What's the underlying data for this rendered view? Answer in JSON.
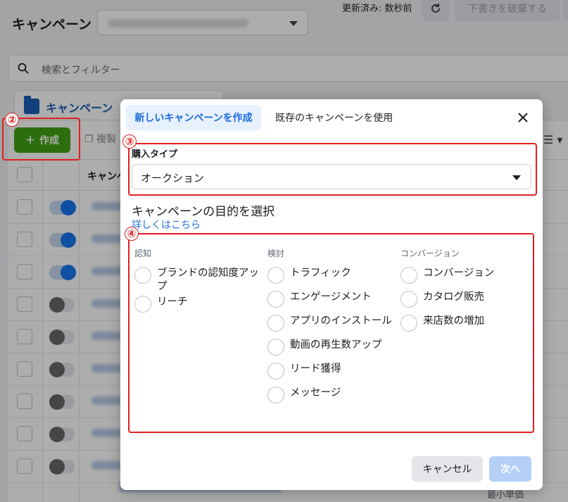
{
  "header": {
    "title": "キャンペーン",
    "updated_text": "更新済み: 数秒前",
    "discard_label": "下書きを破棄する"
  },
  "search": {
    "placeholder": "検索とフィルター"
  },
  "tabs": {
    "campaign_label": "キャンペーン"
  },
  "toolbar": {
    "create_label": "作成",
    "duplicate_label": "複製"
  },
  "table": {
    "header_name": "キャンペ",
    "rows": [
      {
        "toggle": "on"
      },
      {
        "toggle": "on"
      },
      {
        "toggle": "on"
      },
      {
        "toggle": "off"
      },
      {
        "toggle": "off"
      },
      {
        "toggle": "off"
      },
      {
        "toggle": "off"
      },
      {
        "toggle": "off"
      },
      {
        "toggle": "off"
      }
    ],
    "footer_label": "最小単価"
  },
  "annotations": {
    "m2": "②",
    "m3": "③",
    "m4": "④"
  },
  "modal": {
    "tab_new": "新しいキャンペーンを作成",
    "tab_existing": "既存のキャンペーンを使用",
    "purchase_type_label": "購入タイプ",
    "purchase_type_value": "オークション",
    "objective_title": "キャンペーンの目的を選択",
    "learn_more": "詳しくはこちら",
    "columns": [
      {
        "title": "認知",
        "items": [
          "ブランドの認知度アップ",
          "リーチ"
        ]
      },
      {
        "title": "検討",
        "items": [
          "トラフィック",
          "エンゲージメント",
          "アプリのインストール",
          "動画の再生数アップ",
          "リード獲得",
          "メッセージ"
        ]
      },
      {
        "title": "コンバージョン",
        "items": [
          "コンバージョン",
          "カタログ販売",
          "来店数の増加"
        ]
      }
    ],
    "cancel_label": "キャンセル",
    "next_label": "次へ"
  }
}
